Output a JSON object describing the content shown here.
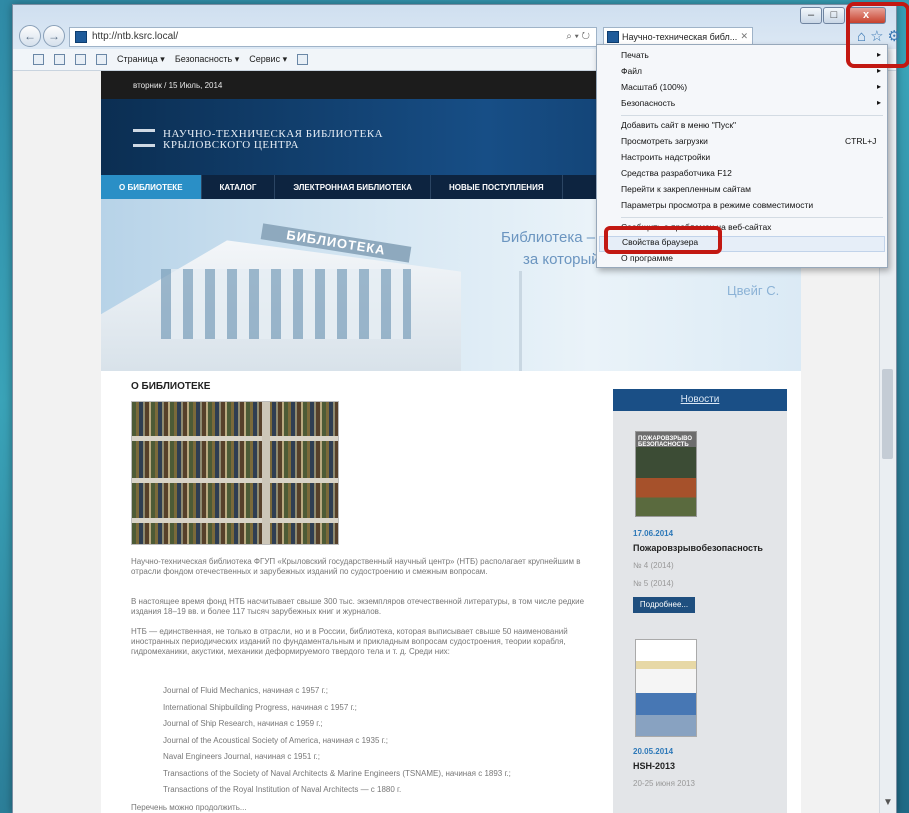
{
  "browser": {
    "address": "http://ntb.ksrc.local/",
    "tab_title": "Научно-техническая библ...",
    "window_controls": {
      "minimize": "–",
      "maximize": "□",
      "close": "x"
    },
    "cmdbar": {
      "page": "Страница ▾",
      "safety": "Безопасность ▾",
      "service": "Сервис ▾"
    }
  },
  "site": {
    "date": "вторник / 15 Июль, 2014",
    "logo_line1": "НАУЧНО-ТЕХНИЧЕСКАЯ БИБЛИОТЕКА",
    "logo_line2": "КРЫЛОВСКОГО ЦЕНТРА",
    "nav": [
      "О БИБЛИОТЕКЕ",
      "КАТАЛОГ",
      "ЭЛЕКТРОННАЯ БИБЛИОТЕКА",
      "НОВЫЕ ПОСТУПЛЕНИЯ"
    ],
    "hero_sign": "БИБЛИОТЕКА",
    "hero_quote_1": "Библиотека –",
    "hero_quote_2": "за который",
    "hero_author": "Цвейг С.",
    "section_title": "О БИБЛИОТЕКЕ",
    "para1": "Научно-техническая библиотека ФГУП «Крыловский государственный научный центр» (НТБ) располагает крупнейшим в отрасли фондом отечественных и зарубежных изданий по судостроению и смежным вопросам.",
    "para2": "В настоящее время фонд НТБ насчитывает свыше 300 тыс. экземпляров отечественной литературы, в том числе редкие издания 18–19 вв. и более 117 тысяч зарубежных книг и журналов.",
    "para3": "НТБ — единственная, не только в отрасли, но и в России, библиотека, которая выписывает свыше 50 наименований иностранных периодических изданий по фундаментальным и прикладным вопросам судостроения, теории корабля, гидромеханики, акустики, механики деформируемого твердого тела и т. д. Среди них:",
    "journals": [
      "Journal of Fluid Mechanics, начиная с 1957 г.;",
      "International Shipbuilding Progress, начиная с 1957 г.;",
      "Journal of Ship Research, начиная с 1959 г.;",
      "Journal of the Acoustical Society of America, начиная с 1935 г.;",
      "Naval Engineers Journal, начиная с 1951 г.;",
      "Transactions of the Society of Naval Architects & Marine Engineers (TSNAME), начиная с 1893 г.;",
      "Transactions of the Royal Institution of Naval Architects — с 1880 г."
    ],
    "para4": "Перечень можно продолжить..."
  },
  "news": {
    "header": "Новости",
    "item1": {
      "cover_text": "ПОЖАРОВЗРЫВО БЕЗОПАСНОСТЬ",
      "date": "17.06.2014",
      "title": "Пожаровзрывобезопасность",
      "line1": "№ 4 (2014)",
      "line2": "№ 5 (2014)",
      "more": "Подробнее..."
    },
    "item2": {
      "date": "20.05.2014",
      "title": "HSH-2013",
      "line1": "20-25 июня 2013"
    }
  },
  "menu": {
    "items": [
      {
        "label": "Печать",
        "arrow": "▸"
      },
      {
        "label": "Файл",
        "arrow": "▸"
      },
      {
        "label": "Масштаб (100%)",
        "arrow": "▸"
      },
      {
        "label": "Безопасность",
        "arrow": "▸"
      },
      {
        "label": "Добавить сайт в меню \"Пуск\""
      },
      {
        "label": "Просмотреть загрузки",
        "shortcut": "CTRL+J"
      },
      {
        "label": "Настроить надстройки"
      },
      {
        "label": "Средства разработчика F12"
      },
      {
        "label": "Перейти к закрепленным сайтам"
      },
      {
        "label": "Параметры просмотра в режиме совместимости"
      },
      {
        "label": "Сообщить о проблемах на веб-сайтах"
      },
      {
        "label": "Свойства браузера"
      },
      {
        "label": "О программе"
      }
    ]
  },
  "colors": {
    "highlight": "#c21812",
    "site_nav_active": "#2a8fc6",
    "news_header": "#1a4f86"
  }
}
